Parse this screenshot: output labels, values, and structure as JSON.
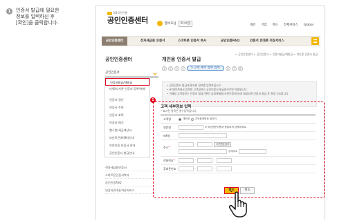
{
  "instruction": {
    "step_number": "1",
    "lines": [
      "인증서 발급에 필요한",
      "정보를 입력하신 후",
      "[확인]을 클릭합니다."
    ]
  },
  "header": {
    "bank_sub": "KB국민은행",
    "title": "공인인증센터",
    "extra_name": "행수호님",
    "login_label": "로그아웃",
    "util_links": [
      "개인",
      "기업",
      "카드",
      "전체서비스",
      "Global"
    ]
  },
  "gnb": {
    "items": [
      "공인인증센터",
      "전자세금용 인증서",
      "스마트폰 인증서 복사",
      "공인인증FAQ",
      "인증서 휴대폰 저장서비스"
    ],
    "menu_icon": "hamburger-icon"
  },
  "lnb": {
    "title": "공인인증센터",
    "select_label": "공인인증서",
    "items": [
      "인증서발급/재발급",
      "타행/타기관 인증서 등록/해제",
      "인증서 갱신",
      "인증서 조회",
      "인증서 효력",
      "인증서 폐기",
      "행스펀/세금계산서",
      "보안토큰(HSM)안내",
      "보안인증 인증서 안내",
      "공인인증서 발급안내"
    ],
    "bottom_items": [
      "전자세금용인증서",
      "스마트폰인증서복사",
      "공인인증FAQ",
      "인증서휴대폰저장서비스"
    ]
  },
  "main": {
    "page_title": "개인용 인증서 발급",
    "breadcrumb": "> 공인인증센터 > 공인인증서 > 인증서발급/재발급 > 개인용 인증서 발급",
    "steps_before": [
      "1",
      "2",
      "3",
      "4"
    ],
    "current_step": "5 고객 세부 정보 입력",
    "steps_after": [
      "6",
      "7",
      "8"
    ],
    "notice_lines": [
      "• 공인인증서 발급에 필요한 정보를 입력하십시오.",
      "• 본 페이지에서 입력한 고객정보는 공인인증서 발급용으로만 이용됩니다.",
      "• 이메일 고객정보는 인증서 발급기관인 금융결제원(국민인증센터)에 제공되며 인증서 발급 후 변경 가능합니다."
    ]
  },
  "form": {
    "badge": "1",
    "title": "고객 세부정보 입력",
    "subtitle": "• 표시된 항목은 필수입력입니다.",
    "rows": {
      "customer_type": "고객명",
      "customer_type_opt1": "개인명",
      "customer_type_opt2": "주민등록번호 뒷자리",
      "english_name": "영문명",
      "english_hint": "※ 여권영문이름과 동일하게 입력하세요.",
      "email": "e메일",
      "address": "주소",
      "zip_btn": "우편번호검색",
      "address_detail": "상세주소",
      "phone": "전화번호",
      "mobile": "휴대폰번호"
    },
    "confirm_label": "확인",
    "cancel_label": "취소"
  },
  "colors": {
    "accent": "#f2b705",
    "highlight": "#e4001b",
    "nav_active": "#8c7f71"
  }
}
